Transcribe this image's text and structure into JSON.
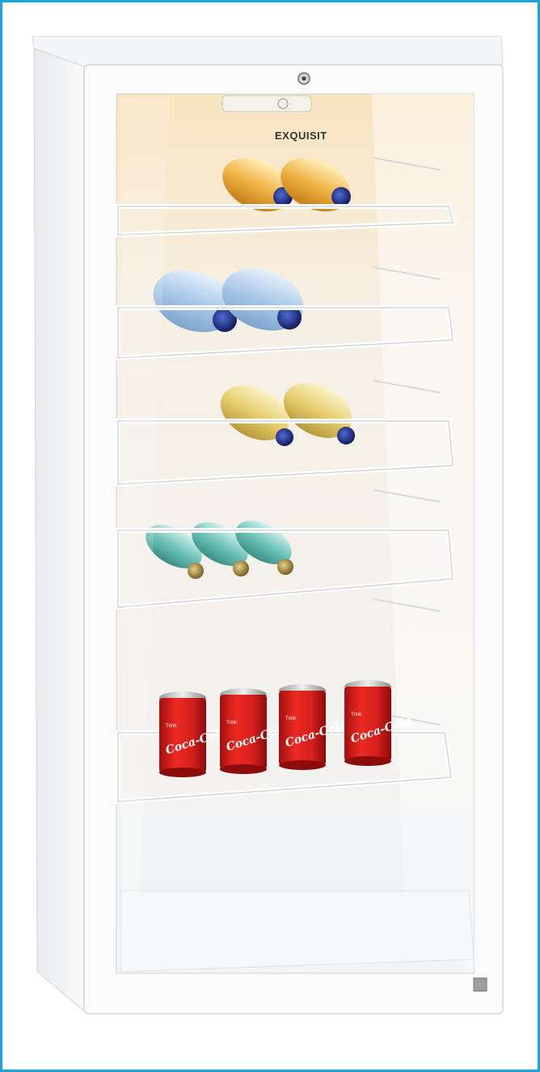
{
  "image": {
    "subject": "glass-door beverage refrigerator",
    "frame_color": "#1aa3dc",
    "cabinet_color": "#f7f7f7",
    "interior_light_color": "#fbe6c2"
  },
  "branding": {
    "logo_text": "EXQUISIT"
  },
  "shelves": [
    {
      "name": "shelf-1",
      "contents": "2 bottles orange drink"
    },
    {
      "name": "shelf-2",
      "contents": "2 bottles still water"
    },
    {
      "name": "shelf-3",
      "contents": "2 bottles white wine"
    },
    {
      "name": "shelf-4",
      "contents": "3 bottles green glass"
    },
    {
      "name": "shelf-5",
      "contents": "4 cans cola"
    }
  ],
  "cans": {
    "brand_text": "Coca-Cola",
    "small_text": "Trink",
    "color": "#d61f1f"
  }
}
